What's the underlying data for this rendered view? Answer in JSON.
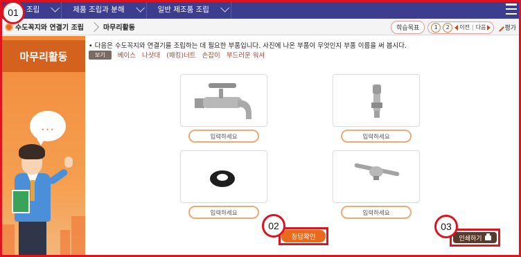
{
  "topnav": {
    "items": [
      {
        "label": "조립"
      },
      {
        "label": "제품 조립과 분해"
      },
      {
        "label": "일반 제조품 조립"
      }
    ]
  },
  "badges": [
    "01",
    "02",
    "03"
  ],
  "breadcrumb": {
    "item1": "수도꼭지와 연결기 조립",
    "item2": "마무리활동"
  },
  "tools": {
    "goal": "학습목표",
    "page1": "1",
    "page2": "2",
    "prev": "이전",
    "next": "다음",
    "eval": "평가"
  },
  "sidebar": {
    "title": "마무리활동",
    "bubble": "..."
  },
  "instruction": "• 다음은 수도꼭지와 연결기를 조립하는 데 필요한 부품입니다. 사진에 나온 부품이 무엇인지 부품 이름을 써 봅시다.",
  "hints": {
    "label": "보기",
    "words": [
      "베이스",
      "나삿대",
      "(패킹)너트",
      "손잡이",
      "부드러운 워셔"
    ]
  },
  "parts": [
    {
      "icon": "faucet-image",
      "placeholder": "입력하세요"
    },
    {
      "icon": "screw-rod-image",
      "placeholder": "입력하세요"
    },
    {
      "icon": "rubber-washer-image",
      "placeholder": "입력하세요"
    },
    {
      "icon": "handle-image",
      "placeholder": "입력하세요"
    }
  ],
  "buttons": {
    "check": "정답확인",
    "print": "인쇄하기"
  },
  "colors": {
    "nav": "#3d3d8f",
    "accent": "#e86a1c",
    "highlight": "#e0121d"
  }
}
